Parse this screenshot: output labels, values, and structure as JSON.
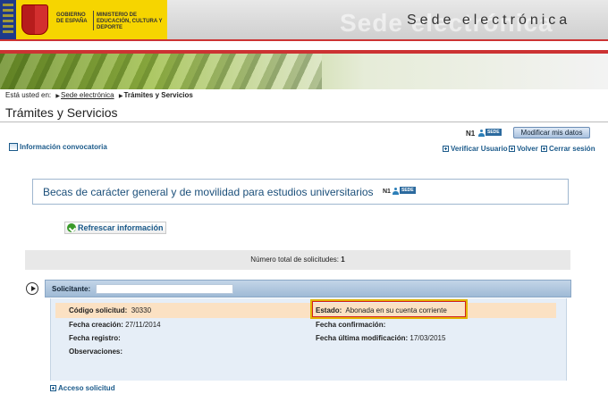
{
  "header": {
    "gov_line1": "GOBIERNO DE ESPAÑA",
    "ministry_line": "MINISTERIO DE EDUCACIÓN, CULTURA Y DEPORTE",
    "site_title": "Sede electrónica",
    "site_title_ghost": "Sede electrónica",
    "accent_color": "#cc3333",
    "gov_yellow": "#f6d500"
  },
  "breadcrumb": {
    "prefix": "Está usted en:",
    "items": [
      "Sede electrónica",
      "Trámites y Servicios"
    ]
  },
  "page_title": "Trámites y Servicios",
  "user_bar": {
    "level": "N1",
    "badge": "SEDE",
    "modify_button": "Modificar mis datos"
  },
  "tools": {
    "info_convocatoria": "Información convocatoria",
    "verificar": "Verificar Usuario",
    "volver": "Volver",
    "cerrar": "Cerrar sesión"
  },
  "convocatoria": {
    "title": "Becas de carácter general y de movilidad para estudios universitarios",
    "level": "N1",
    "badge": "SEDE"
  },
  "refresh_button": "Refrescar información",
  "total": {
    "label": "Número total de solicitudes:",
    "value": "1"
  },
  "solicitud": {
    "solicitante_label": "Solicitante:",
    "solicitante_value": "",
    "codigo_label": "Código solicitud:",
    "codigo_value": "30330",
    "estado_label": "Estado:",
    "estado_value": "Abonada en su cuenta corriente",
    "fecha_creacion_label": "Fecha creación:",
    "fecha_creacion_value": "27/11/2014",
    "fecha_confirmacion_label": "Fecha confirmación:",
    "fecha_confirmacion_value": "",
    "fecha_registro_label": "Fecha registro:",
    "fecha_registro_value": "",
    "fecha_ultima_label": "Fecha última modificación:",
    "fecha_ultima_value": "17/03/2015",
    "observaciones_label": "Observaciones:",
    "observaciones_value": ""
  },
  "acceso_link": "Acceso solicitud"
}
